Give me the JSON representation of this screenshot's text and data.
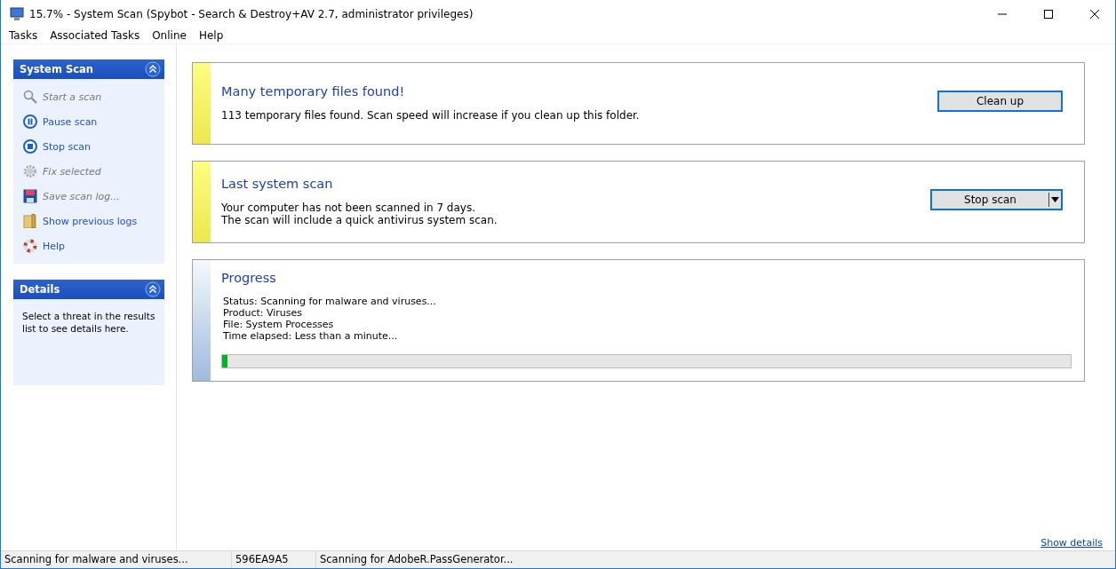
{
  "window": {
    "title": "15.7% - System Scan (Spybot - Search & Destroy+AV 2.7, administrator privileges)"
  },
  "menu": [
    "Tasks",
    "Associated Tasks",
    "Online",
    "Help"
  ],
  "sidebar": {
    "panels": [
      {
        "title": "System Scan",
        "expanded": true,
        "items": [
          {
            "label": "Start a scan",
            "kind": "search",
            "disabled": true
          },
          {
            "label": "Pause scan",
            "kind": "pause",
            "disabled": false
          },
          {
            "label": "Stop scan",
            "kind": "stop",
            "disabled": false
          },
          {
            "label": "Fix selected",
            "kind": "gear",
            "disabled": true
          },
          {
            "label": "Save scan log...",
            "kind": "floppy",
            "disabled": true
          },
          {
            "label": "Show previous logs",
            "kind": "folder",
            "disabled": false
          },
          {
            "label": "Help",
            "kind": "lifebuoy",
            "disabled": false
          }
        ]
      },
      {
        "title": "Details",
        "expanded": true,
        "text": "Select a threat in the results list to see details here."
      }
    ]
  },
  "cards": [
    {
      "kind": "warning",
      "title": "Many temporary files found!",
      "lines": [
        "113 temporary files found. Scan speed will increase if you clean up this folder."
      ],
      "button": {
        "label": "Clean up",
        "dropdown": false
      }
    },
    {
      "kind": "warning",
      "title": "Last system scan",
      "lines": [
        "Your computer has not been scanned in 7 days.",
        "The scan will include a quick antivirus system scan."
      ],
      "button": {
        "label": "Stop scan",
        "dropdown": true
      }
    },
    {
      "kind": "progress",
      "title": "Progress",
      "lines": [
        "Status: Scanning for malware and viruses...",
        "Product: Viruses",
        "File: System Processes",
        "Time elapsed: Less than a minute..."
      ],
      "level": 0.006
    }
  ],
  "details_link": "Show details",
  "status_bar": [
    "Scanning for malware and viruses...",
    "596EA9A5",
    "Scanning for AdobeR.PassGenerator..."
  ]
}
